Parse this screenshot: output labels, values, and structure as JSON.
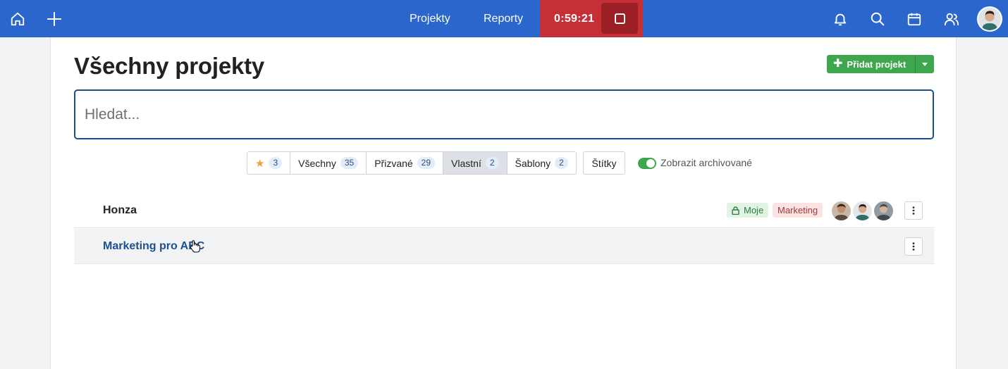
{
  "topbar": {
    "nav": [
      "Projekty",
      "Reporty"
    ],
    "timer": "0:59:21",
    "icons": [
      "home-icon",
      "plus-icon",
      "bell-icon",
      "search-icon",
      "calendar-icon",
      "users-icon"
    ]
  },
  "page": {
    "title": "Všechny projekty",
    "add_button": "Přidat projekt",
    "search_placeholder": "Hledat..."
  },
  "filters": [
    {
      "label": "",
      "count": "3",
      "icon": "star-icon"
    },
    {
      "label": "Všechny",
      "count": "35"
    },
    {
      "label": "Přizvané",
      "count": "29"
    },
    {
      "label": "Vlastní",
      "count": "2",
      "active": true
    },
    {
      "label": "Šablony",
      "count": "2"
    }
  ],
  "tags_button": "Štítky",
  "archive_toggle": {
    "label": "Zobrazit archivované",
    "on": true
  },
  "projects": [
    {
      "name": "Honza",
      "badges": [
        "Moje",
        "Marketing"
      ]
    },
    {
      "name": "Marketing pro ABC"
    }
  ],
  "colors": {
    "topbar": "#2a66cc",
    "timer": "#c72f36",
    "accent_green": "#3ea64c",
    "link": "#1d4f91"
  }
}
